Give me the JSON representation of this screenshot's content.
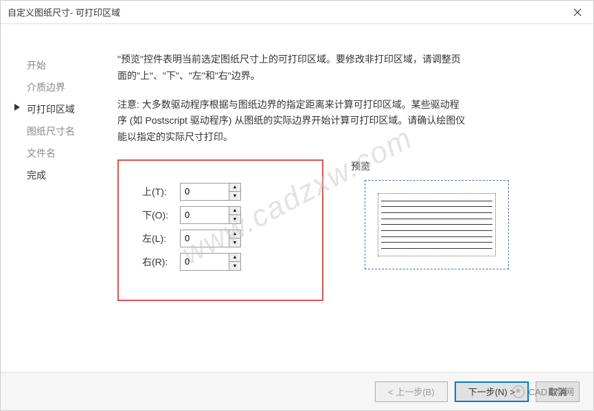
{
  "title": "自定义图纸尺寸- 可打印区域",
  "sidebar": [
    {
      "label": "开始",
      "state": ""
    },
    {
      "label": "介质边界",
      "state": ""
    },
    {
      "label": "可打印区域",
      "state": "active"
    },
    {
      "label": "图纸尺寸名",
      "state": ""
    },
    {
      "label": "文件名",
      "state": ""
    },
    {
      "label": "完成",
      "state": "done"
    }
  ],
  "para1": "\"预览\"控件表明当前选定图纸尺寸上的可打印区域。要修改非打印区域，请调整页面的\"上\"、\"下\"、\"左\"和\"右\"边界。",
  "para2": "注意: 大多数驱动程序根据与图纸边界的指定距离来计算可打印区域。某些驱动程序 (如 Postscript 驱动程序) 从图纸的实际边界开始计算可打印区域。请确认绘图仪能以指定的实际尺寸打印。",
  "margins": {
    "top": {
      "label": "上(T):",
      "value": "0"
    },
    "bottom": {
      "label": "下(O):",
      "value": "0"
    },
    "left": {
      "label": "左(L):",
      "value": "0"
    },
    "right": {
      "label": "右(R):",
      "value": "0"
    }
  },
  "preview_label": "预览",
  "buttons": {
    "back": "< 上一步(B)",
    "next": "下一步(N) >",
    "cancel": "取消"
  },
  "watermark": "www.cadzxw.com",
  "badge": "CAD自学网"
}
